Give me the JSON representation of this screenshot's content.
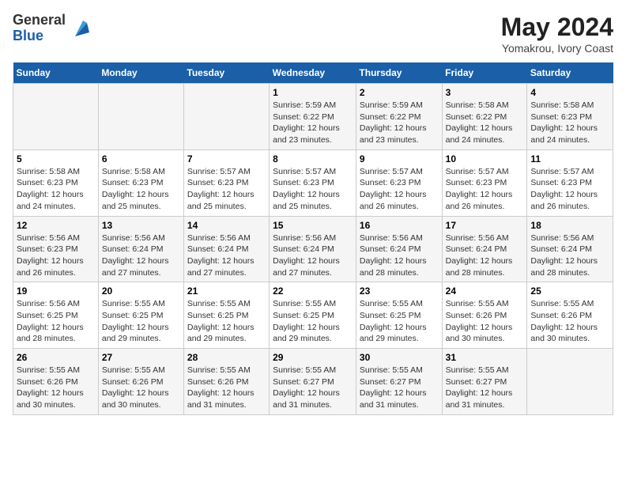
{
  "logo": {
    "general": "General",
    "blue": "Blue"
  },
  "header": {
    "title": "May 2024",
    "subtitle": "Yomakrou, Ivory Coast"
  },
  "days_of_week": [
    "Sunday",
    "Monday",
    "Tuesday",
    "Wednesday",
    "Thursday",
    "Friday",
    "Saturday"
  ],
  "weeks": [
    [
      {
        "day": "",
        "info": ""
      },
      {
        "day": "",
        "info": ""
      },
      {
        "day": "",
        "info": ""
      },
      {
        "day": "1",
        "info": "Sunrise: 5:59 AM\nSunset: 6:22 PM\nDaylight: 12 hours and 23 minutes."
      },
      {
        "day": "2",
        "info": "Sunrise: 5:59 AM\nSunset: 6:22 PM\nDaylight: 12 hours and 23 minutes."
      },
      {
        "day": "3",
        "info": "Sunrise: 5:58 AM\nSunset: 6:22 PM\nDaylight: 12 hours and 24 minutes."
      },
      {
        "day": "4",
        "info": "Sunrise: 5:58 AM\nSunset: 6:23 PM\nDaylight: 12 hours and 24 minutes."
      }
    ],
    [
      {
        "day": "5",
        "info": "Sunrise: 5:58 AM\nSunset: 6:23 PM\nDaylight: 12 hours and 24 minutes."
      },
      {
        "day": "6",
        "info": "Sunrise: 5:58 AM\nSunset: 6:23 PM\nDaylight: 12 hours and 25 minutes."
      },
      {
        "day": "7",
        "info": "Sunrise: 5:57 AM\nSunset: 6:23 PM\nDaylight: 12 hours and 25 minutes."
      },
      {
        "day": "8",
        "info": "Sunrise: 5:57 AM\nSunset: 6:23 PM\nDaylight: 12 hours and 25 minutes."
      },
      {
        "day": "9",
        "info": "Sunrise: 5:57 AM\nSunset: 6:23 PM\nDaylight: 12 hours and 26 minutes."
      },
      {
        "day": "10",
        "info": "Sunrise: 5:57 AM\nSunset: 6:23 PM\nDaylight: 12 hours and 26 minutes."
      },
      {
        "day": "11",
        "info": "Sunrise: 5:57 AM\nSunset: 6:23 PM\nDaylight: 12 hours and 26 minutes."
      }
    ],
    [
      {
        "day": "12",
        "info": "Sunrise: 5:56 AM\nSunset: 6:23 PM\nDaylight: 12 hours and 26 minutes."
      },
      {
        "day": "13",
        "info": "Sunrise: 5:56 AM\nSunset: 6:24 PM\nDaylight: 12 hours and 27 minutes."
      },
      {
        "day": "14",
        "info": "Sunrise: 5:56 AM\nSunset: 6:24 PM\nDaylight: 12 hours and 27 minutes."
      },
      {
        "day": "15",
        "info": "Sunrise: 5:56 AM\nSunset: 6:24 PM\nDaylight: 12 hours and 27 minutes."
      },
      {
        "day": "16",
        "info": "Sunrise: 5:56 AM\nSunset: 6:24 PM\nDaylight: 12 hours and 28 minutes."
      },
      {
        "day": "17",
        "info": "Sunrise: 5:56 AM\nSunset: 6:24 PM\nDaylight: 12 hours and 28 minutes."
      },
      {
        "day": "18",
        "info": "Sunrise: 5:56 AM\nSunset: 6:24 PM\nDaylight: 12 hours and 28 minutes."
      }
    ],
    [
      {
        "day": "19",
        "info": "Sunrise: 5:56 AM\nSunset: 6:25 PM\nDaylight: 12 hours and 28 minutes."
      },
      {
        "day": "20",
        "info": "Sunrise: 5:55 AM\nSunset: 6:25 PM\nDaylight: 12 hours and 29 minutes."
      },
      {
        "day": "21",
        "info": "Sunrise: 5:55 AM\nSunset: 6:25 PM\nDaylight: 12 hours and 29 minutes."
      },
      {
        "day": "22",
        "info": "Sunrise: 5:55 AM\nSunset: 6:25 PM\nDaylight: 12 hours and 29 minutes."
      },
      {
        "day": "23",
        "info": "Sunrise: 5:55 AM\nSunset: 6:25 PM\nDaylight: 12 hours and 29 minutes."
      },
      {
        "day": "24",
        "info": "Sunrise: 5:55 AM\nSunset: 6:26 PM\nDaylight: 12 hours and 30 minutes."
      },
      {
        "day": "25",
        "info": "Sunrise: 5:55 AM\nSunset: 6:26 PM\nDaylight: 12 hours and 30 minutes."
      }
    ],
    [
      {
        "day": "26",
        "info": "Sunrise: 5:55 AM\nSunset: 6:26 PM\nDaylight: 12 hours and 30 minutes."
      },
      {
        "day": "27",
        "info": "Sunrise: 5:55 AM\nSunset: 6:26 PM\nDaylight: 12 hours and 30 minutes."
      },
      {
        "day": "28",
        "info": "Sunrise: 5:55 AM\nSunset: 6:26 PM\nDaylight: 12 hours and 31 minutes."
      },
      {
        "day": "29",
        "info": "Sunrise: 5:55 AM\nSunset: 6:27 PM\nDaylight: 12 hours and 31 minutes."
      },
      {
        "day": "30",
        "info": "Sunrise: 5:55 AM\nSunset: 6:27 PM\nDaylight: 12 hours and 31 minutes."
      },
      {
        "day": "31",
        "info": "Sunrise: 5:55 AM\nSunset: 6:27 PM\nDaylight: 12 hours and 31 minutes."
      },
      {
        "day": "",
        "info": ""
      }
    ]
  ]
}
